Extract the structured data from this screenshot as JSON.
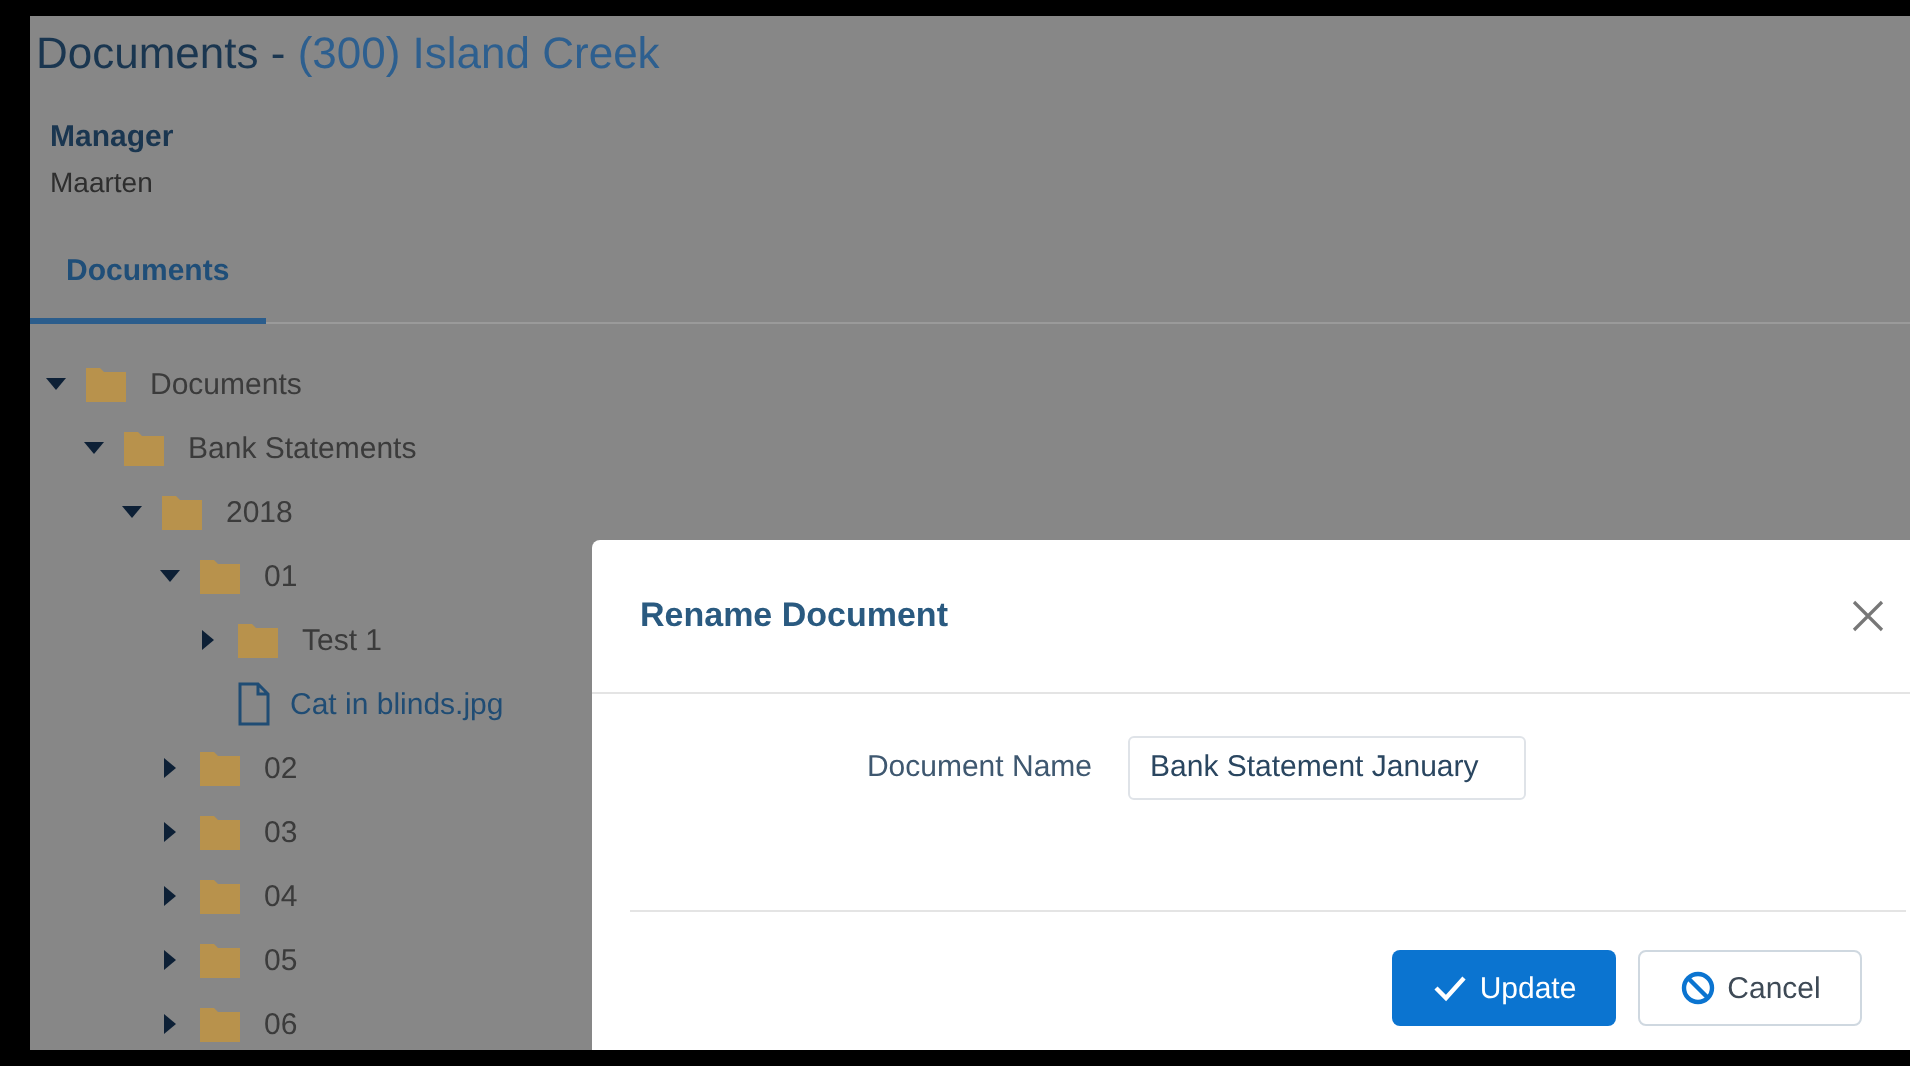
{
  "page": {
    "title": "Documents - ",
    "title_link": "(300) Island Creek",
    "manager_label": "Manager",
    "manager_name": "Maarten"
  },
  "tabs": [
    {
      "label": "Documents",
      "selected": true
    }
  ],
  "tree": [
    {
      "kind": "folder",
      "label": "Documents",
      "expanded": true,
      "children": [
        {
          "kind": "folder",
          "label": "Bank Statements",
          "expanded": true,
          "children": [
            {
              "kind": "folder",
              "label": "2018",
              "expanded": true,
              "children": [
                {
                  "kind": "folder",
                  "label": "01",
                  "expanded": true,
                  "children": [
                    {
                      "kind": "folder",
                      "label": "Test 1",
                      "expanded": false
                    },
                    {
                      "kind": "file",
                      "label": "Cat in blinds.jpg"
                    }
                  ]
                },
                {
                  "kind": "folder",
                  "label": "02",
                  "expanded": false
                },
                {
                  "kind": "folder",
                  "label": "03",
                  "expanded": false
                },
                {
                  "kind": "folder",
                  "label": "04",
                  "expanded": false
                },
                {
                  "kind": "folder",
                  "label": "05",
                  "expanded": false
                },
                {
                  "kind": "folder",
                  "label": "06",
                  "expanded": false
                }
              ]
            }
          ]
        }
      ]
    }
  ],
  "dialog": {
    "title": "Rename Document",
    "field_label": "Document Name",
    "field_value": "Bank Statement January",
    "buttons": [
      {
        "kind": "primary",
        "label": "Update"
      },
      {
        "kind": "cancel",
        "label": "Cancel"
      }
    ]
  }
}
